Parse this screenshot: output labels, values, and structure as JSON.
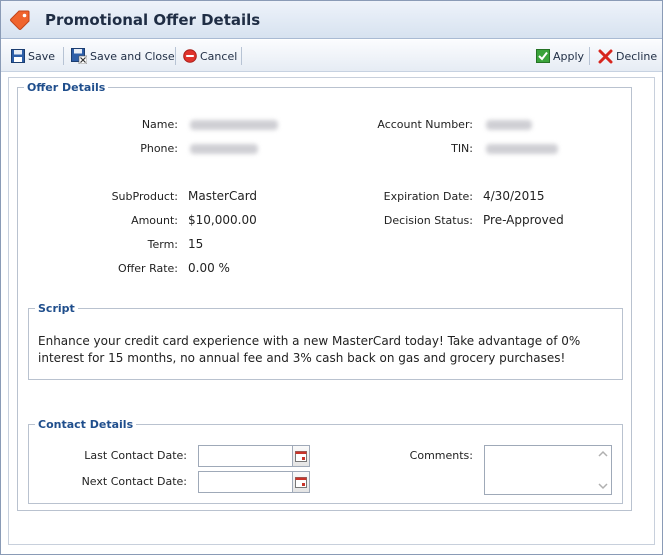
{
  "window": {
    "title": "Promotional Offer Details"
  },
  "toolbar": {
    "save_label": "Save",
    "save_close_label": "Save and Close",
    "cancel_label": "Cancel",
    "apply_label": "Apply",
    "decline_label": "Decline"
  },
  "offer": {
    "legend": "Offer Details",
    "name_label": "Name:",
    "phone_label": "Phone:",
    "account_label": "Account Number:",
    "tin_label": "TIN:",
    "subproduct_label": "SubProduct:",
    "subproduct_value": "MasterCard",
    "amount_label": "Amount:",
    "amount_value": "$10,000.00",
    "term_label": "Term:",
    "term_value": "15",
    "rate_label": "Offer Rate:",
    "rate_value": "0.00 %",
    "expiration_label": "Expiration Date:",
    "expiration_value": "4/30/2015",
    "decision_label": "Decision Status:",
    "decision_value": "Pre-Approved"
  },
  "script": {
    "legend": "Script",
    "text": "Enhance your credit card experience with a new MasterCard today! Take advantage of 0% interest for 15 months, no annual fee and 3% cash back on gas and grocery purchases!"
  },
  "contact": {
    "legend": "Contact Details",
    "last_label": "Last Contact Date:",
    "last_value": "",
    "next_label": "Next Contact Date:",
    "next_value": "",
    "comments_label": "Comments:",
    "comments_value": ""
  },
  "icons": {
    "title": "tag-icon",
    "save": "floppy-disk-icon",
    "save_close": "floppy-disk-close-icon",
    "cancel": "cancel-icon",
    "apply": "checkbox-check-icon",
    "decline": "red-x-icon",
    "calendar": "calendar-icon"
  }
}
